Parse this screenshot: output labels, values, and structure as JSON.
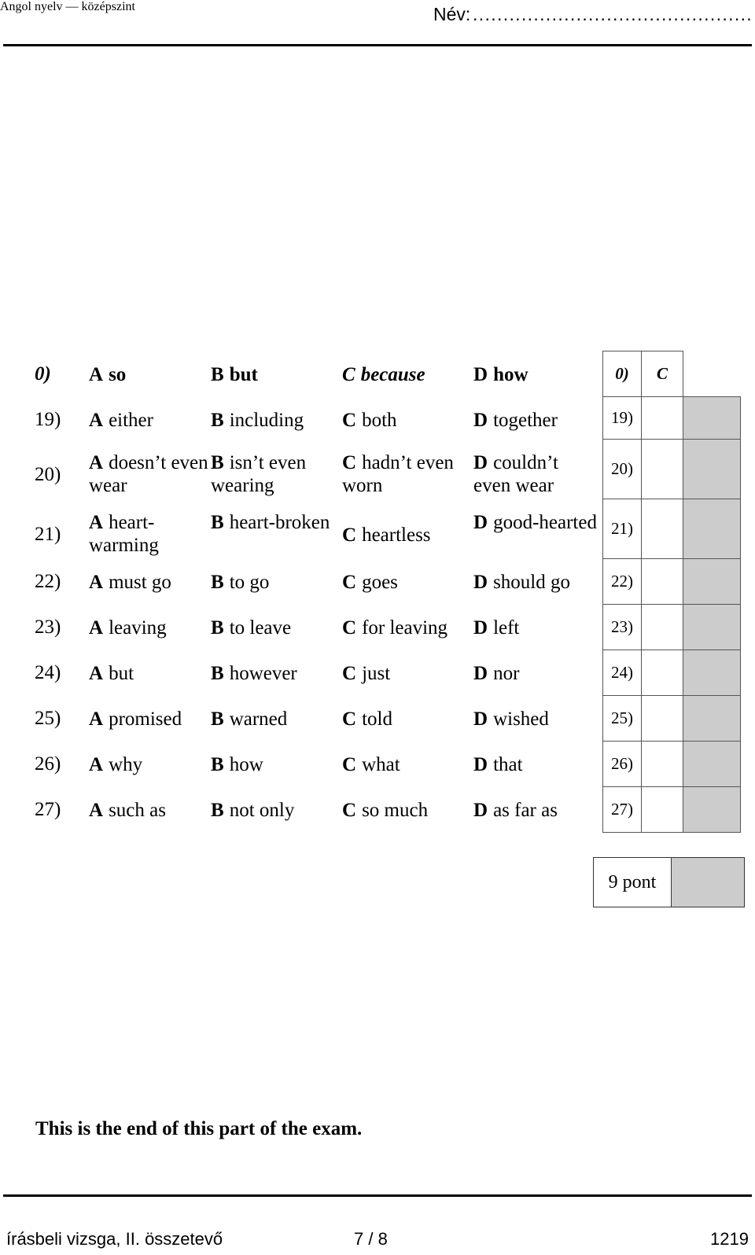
{
  "header": {
    "subject": "Angol nyelv — középszint",
    "name_label": "Név:",
    "name_dots": "........................................................."
  },
  "exercise": {
    "example_row": {
      "number": "0)",
      "options": [
        {
          "letter": "A",
          "text": "so",
          "is_key": false
        },
        {
          "letter": "B",
          "text": "but",
          "is_key": false
        },
        {
          "letter": "C",
          "text": "because",
          "is_key": true
        },
        {
          "letter": "D",
          "text": "how",
          "is_key": false
        }
      ]
    },
    "rows": [
      {
        "number": "19)",
        "options": [
          {
            "letter": "A",
            "text": "either"
          },
          {
            "letter": "B",
            "text": "including"
          },
          {
            "letter": "C",
            "text": "both"
          },
          {
            "letter": "D",
            "text": "together"
          }
        ]
      },
      {
        "number": "20)",
        "options": [
          {
            "letter": "A",
            "text": "doesn’t even wear"
          },
          {
            "letter": "B",
            "text": "isn’t even wearing"
          },
          {
            "letter": "C",
            "text": "hadn’t even worn"
          },
          {
            "letter": "D",
            "text": "couldn’t even wear"
          }
        ]
      },
      {
        "number": "21)",
        "options": [
          {
            "letter": "A",
            "text": "heart-warming"
          },
          {
            "letter": "B",
            "text": "heart-broken"
          },
          {
            "letter": "C",
            "text": "heartless"
          },
          {
            "letter": "D",
            "text": "good-hearted"
          }
        ]
      },
      {
        "number": "22)",
        "options": [
          {
            "letter": "A",
            "text": "must go"
          },
          {
            "letter": "B",
            "text": "to go"
          },
          {
            "letter": "C",
            "text": "goes"
          },
          {
            "letter": "D",
            "text": "should go"
          }
        ]
      },
      {
        "number": "23)",
        "options": [
          {
            "letter": "A",
            "text": "leaving"
          },
          {
            "letter": "B",
            "text": "to leave"
          },
          {
            "letter": "C",
            "text": "for leaving"
          },
          {
            "letter": "D",
            "text": "left"
          }
        ]
      },
      {
        "number": "24)",
        "options": [
          {
            "letter": "A",
            "text": "but"
          },
          {
            "letter": "B",
            "text": "however"
          },
          {
            "letter": "C",
            "text": "just"
          },
          {
            "letter": "D",
            "text": "nor"
          }
        ]
      },
      {
        "number": "25)",
        "options": [
          {
            "letter": "A",
            "text": "promised"
          },
          {
            "letter": "B",
            "text": "warned"
          },
          {
            "letter": "C",
            "text": "told"
          },
          {
            "letter": "D",
            "text": "wished"
          }
        ]
      },
      {
        "number": "26)",
        "options": [
          {
            "letter": "A",
            "text": "why"
          },
          {
            "letter": "B",
            "text": "how"
          },
          {
            "letter": "C",
            "text": "what"
          },
          {
            "letter": "D",
            "text": "that"
          }
        ]
      },
      {
        "number": "27)",
        "options": [
          {
            "letter": "A",
            "text": "such as"
          },
          {
            "letter": "B",
            "text": "not only"
          },
          {
            "letter": "C",
            "text": "so much"
          },
          {
            "letter": "D",
            "text": "as far as"
          }
        ]
      }
    ]
  },
  "answer_grid": {
    "example": {
      "number": "0)",
      "answer": "C"
    },
    "rows": [
      {
        "number": "19)",
        "answer": ""
      },
      {
        "number": "20)",
        "answer": ""
      },
      {
        "number": "21)",
        "answer": ""
      },
      {
        "number": "22)",
        "answer": ""
      },
      {
        "number": "23)",
        "answer": ""
      },
      {
        "number": "24)",
        "answer": ""
      },
      {
        "number": "25)",
        "answer": ""
      },
      {
        "number": "26)",
        "answer": ""
      },
      {
        "number": "27)",
        "answer": ""
      }
    ]
  },
  "points_box": {
    "label": "9 pont",
    "score": ""
  },
  "closing_note": "This is the end of this part of the exam.",
  "footer": {
    "exam_part": "írásbeli vizsga, II. összetevő",
    "page": "7 / 8",
    "code": "1219"
  },
  "colors": {
    "ink": "#000000",
    "grid_line": "#555555",
    "shaded_cell": "#cccccc",
    "page": "#ffffff"
  }
}
